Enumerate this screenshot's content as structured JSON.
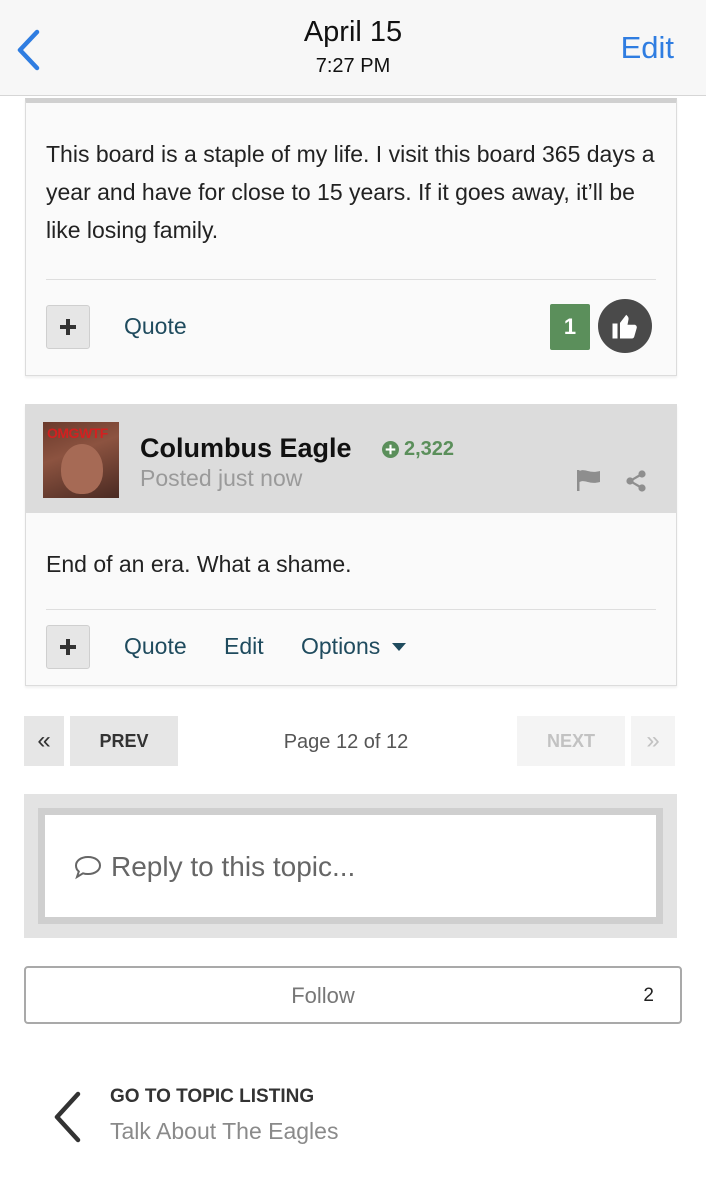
{
  "topbar": {
    "date": "April 15",
    "time": "7:27 PM",
    "edit_label": "Edit"
  },
  "post1": {
    "body": "This board is a staple of my life. I visit this board 365 days a year and have for close to 15 years. If it goes away, it’ll be like losing family.",
    "plus_label": "+",
    "quote_label": "Quote",
    "reaction_count": "1"
  },
  "post2": {
    "avatar_text": "OMGWTF",
    "author": "Columbus Eagle",
    "reputation": "2,322",
    "posted": "Posted just now",
    "body": "End of an era. What a shame.",
    "plus_label": "+",
    "quote_label": "Quote",
    "edit_label": "Edit",
    "options_label": "Options"
  },
  "pagination": {
    "first": "«",
    "prev": "PREV",
    "info": "Page 12 of 12",
    "next": "NEXT",
    "last": "»"
  },
  "reply": {
    "placeholder": "Reply to this topic..."
  },
  "follow": {
    "label": "Follow",
    "count": "2"
  },
  "topic_nav": {
    "title": "GO TO TOPIC LISTING",
    "forum": "Talk About The Eagles"
  },
  "colors": {
    "accent": "#2f7de1",
    "reputation": "#5b8f5b",
    "link": "#1f4b5e"
  }
}
